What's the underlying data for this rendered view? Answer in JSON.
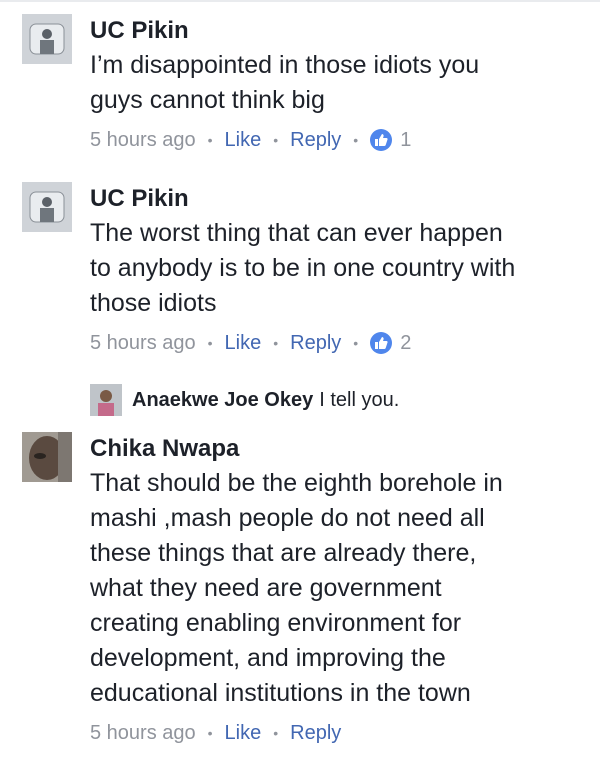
{
  "comments": [
    {
      "author": "UC Pikin",
      "text_lines": [
        "I’m disappointed in those idiots you",
        "guys cannot think big"
      ],
      "time": "5 hours ago",
      "like_label": "Like",
      "reply_label": "Reply",
      "reaction_count": "1"
    },
    {
      "author": "UC Pikin",
      "text_lines": [
        "The worst thing that can ever happen",
        "to anybody is to be in one country with",
        "those idiots"
      ],
      "time": "5 hours ago",
      "like_label": "Like",
      "reply_label": "Reply",
      "reaction_count": "2"
    },
    {
      "author": "Chika Nwapa",
      "text_lines": [
        "That should be the eighth borehole in",
        "mashi ,mash people do not need all",
        "these things that are already there,",
        "what they need are government",
        "creating enabling environment for",
        "development, and improving the",
        "educational institutions in the town"
      ],
      "time": "5 hours ago",
      "like_label": "Like",
      "reply_label": "Reply"
    }
  ],
  "reply_preview": {
    "author": "Anaekwe Joe Okey",
    "text": "I tell you."
  },
  "separator": "•",
  "colors": {
    "text": "#1d2129",
    "meta": "#90949c",
    "link": "#4267b2",
    "like_badge": "#4f86ec"
  }
}
